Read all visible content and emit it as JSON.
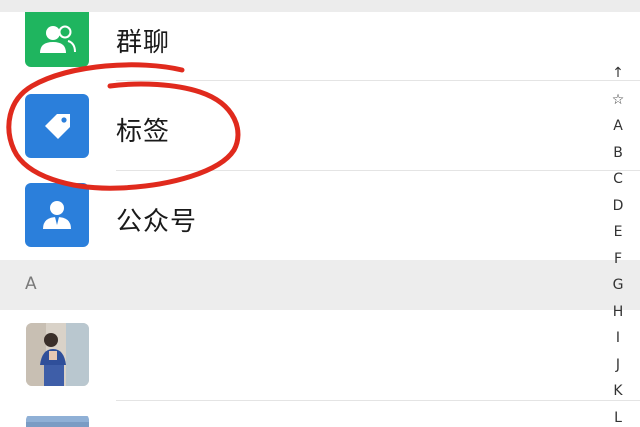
{
  "colors": {
    "group_chat_icon_bg": "#1fb55f",
    "tag_icon_bg": "#2b7fdb",
    "official_icon_bg": "#2b7fdb",
    "section_bg": "#ededed",
    "annotation_red": "#e02a1d"
  },
  "rows": {
    "group_chat": {
      "label": "群聊",
      "icon": "group-chat-icon"
    },
    "tags": {
      "label": "标签",
      "icon": "tag-icon"
    },
    "official_accounts": {
      "label": "公众号",
      "icon": "official-account-icon"
    }
  },
  "section": {
    "letter": "A"
  },
  "index_bar": [
    "↑",
    "☆",
    "A",
    "B",
    "C",
    "D",
    "E",
    "F",
    "G",
    "H",
    "I",
    "J",
    "K",
    "L"
  ]
}
